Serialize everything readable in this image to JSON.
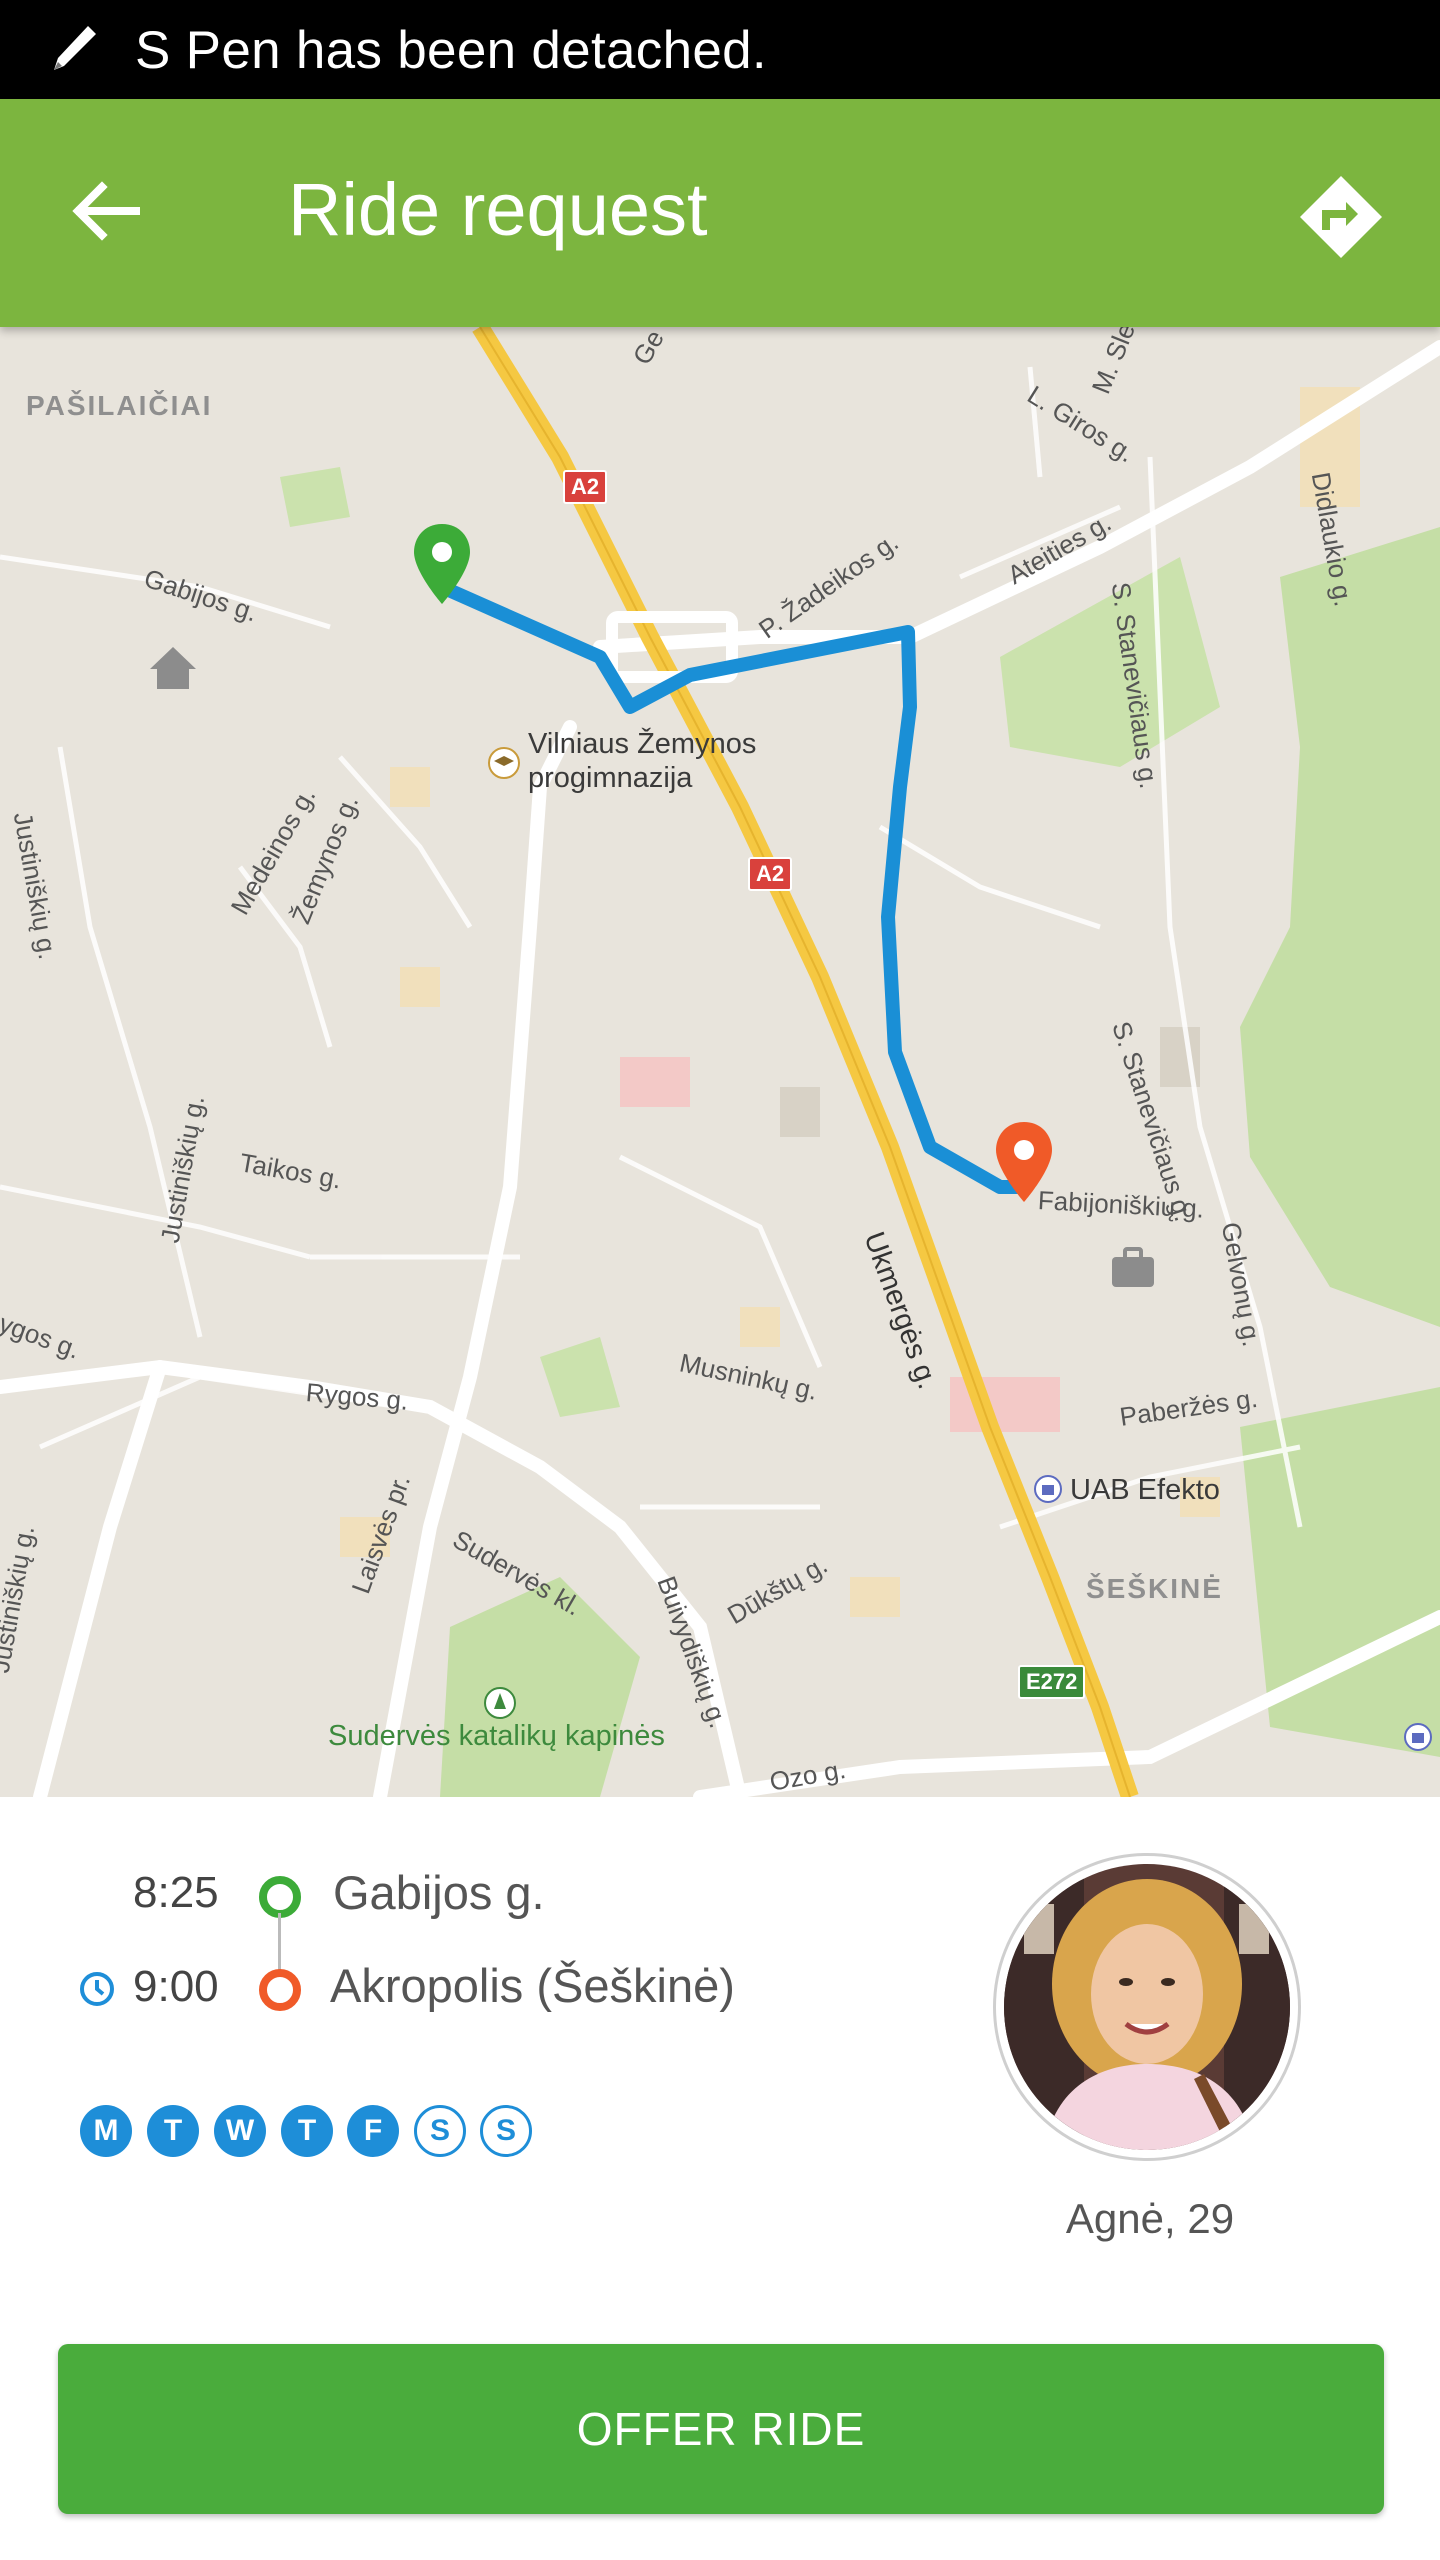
{
  "status_bar": {
    "message": "S Pen has been detached."
  },
  "app_bar": {
    "title": "Ride request"
  },
  "map": {
    "labels": {
      "pasilaiciai": "PAŠILAIČIAI",
      "gabijos": "Gabijos g.",
      "justiniskiu": "Justiniškių g.",
      "justiniskiu2": "Justiniškių g.",
      "justiniskiu3": "Justiniškių g.",
      "medeinos": "Medeinos g.",
      "zemynos": "Žemynos g.",
      "school": "Vilniaus Žemynos progimnazija",
      "giros": "L. Giros g.",
      "zadeikos": "P. Žadeikos g.",
      "ateities": "Ateities g.",
      "staneviciaus": "S. Stanevičiaus g.",
      "staneviciaus2": "S. Stanevičiaus g.",
      "didlaukio": "Didlaukio g.",
      "taikos": "Taikos g.",
      "rygos": "Rygos g.",
      "rygos_left": "ygos g.",
      "ukmerges": "Ukmergės g.",
      "fabijoniskiu": "Fabijoniškių g.",
      "musninku": "Musninkų g.",
      "paberzes": "Paberžės g.",
      "uab": "UAB Efekto",
      "seskine": "ŠEŠKINĖ",
      "laisves": "Laisvės pr.",
      "sudervės": "Sudervės kl.",
      "buivydiskiu": "Buivydiškių g.",
      "dukstu": "Dūkštų g.",
      "cemetery": "Sudervės katalikų kapinės",
      "ozo": "Ozo g.",
      "gelvonu": "Gelvonų g.",
      "slez": "M. Sle",
      "ge": "Ge"
    },
    "badges": {
      "a2_top": "A2",
      "a2_mid": "A2",
      "e272": "E272"
    }
  },
  "ride": {
    "start": {
      "time": "8:25",
      "place": "Gabijos g."
    },
    "end": {
      "time": "9:00",
      "place": "Akropolis (Šeškinė)"
    },
    "days": [
      {
        "label": "M",
        "active": true
      },
      {
        "label": "T",
        "active": true
      },
      {
        "label": "W",
        "active": true
      },
      {
        "label": "T",
        "active": true
      },
      {
        "label": "F",
        "active": true
      },
      {
        "label": "S",
        "active": false
      },
      {
        "label": "S",
        "active": false
      }
    ]
  },
  "driver": {
    "name_age": "Agnė, 29"
  },
  "actions": {
    "offer_label": "OFFER RIDE"
  },
  "colors": {
    "app_bar": "#7cb53f",
    "button": "#4aac3c",
    "route": "#1a8fd6",
    "start_pin": "#3cab38",
    "end_pin": "#f05a28",
    "day_active": "#1e8ed8"
  }
}
